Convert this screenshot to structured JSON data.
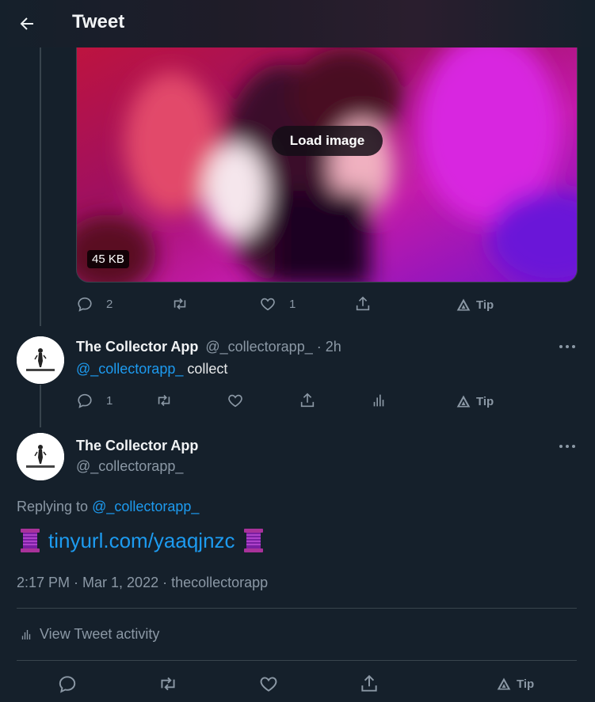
{
  "header": {
    "title": "Tweet"
  },
  "media": {
    "load_label": "Load image",
    "size_badge": "45 KB"
  },
  "tweet1_actions": {
    "replies": "2",
    "likes": "1",
    "tip": "Tip"
  },
  "reply": {
    "name": "The Collector App",
    "handle_time": "@_collectorapp_ · 2h",
    "mention": "@_collectorapp_",
    "text": " collect",
    "replies": "1",
    "tip": "Tip"
  },
  "main": {
    "name": "The Collector App",
    "handle": "@_collectorapp_",
    "replying_prefix": "Replying to ",
    "replying_handle": "@_collectorapp_",
    "link_text": "tinyurl.com/yaaqjnzc",
    "meta": "2:17 PM · Mar 1, 2022 · thecollectorapp",
    "activity": "View Tweet activity",
    "tip": "Tip"
  },
  "colors": {
    "background": "#15202b",
    "link": "#1d9bf0",
    "muted": "#8b98a5",
    "divider": "#38444d"
  },
  "icons": [
    "back-arrow-icon",
    "reply-icon",
    "retweet-icon",
    "like-icon",
    "share-icon",
    "analytics-icon",
    "tip-icon",
    "more-icon",
    "spool-emoji"
  ]
}
